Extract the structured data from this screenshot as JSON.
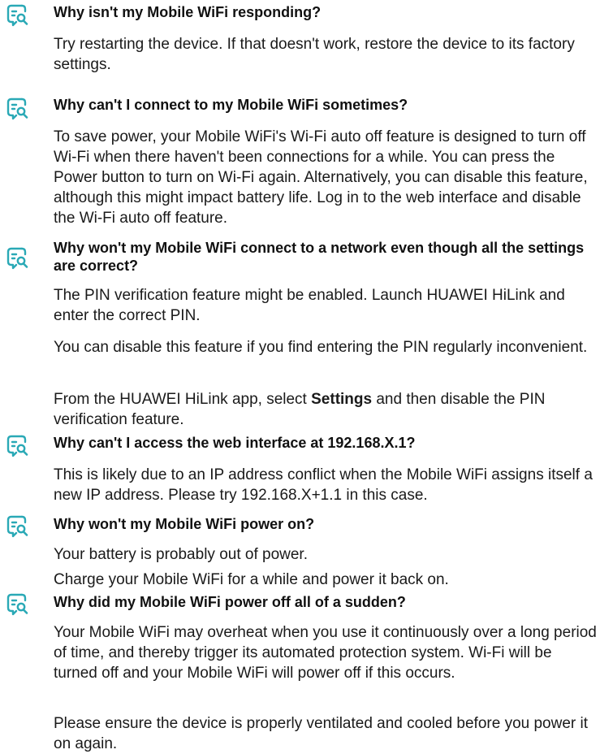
{
  "icon": {
    "name": "faq-search-icon",
    "color": "#2aa9b6"
  },
  "faqs": [
    {
      "question": "Why isn't my Mobile WiFi responding?",
      "answers": [
        "Try restarting the device. If that doesn't work, restore the device to its factory settings."
      ]
    },
    {
      "question": "Why can't I connect to my Mobile WiFi sometimes?",
      "answers": [
        "To save power, your Mobile WiFi's Wi-Fi auto off feature is designed to turn off Wi-Fi when there haven't been connections for a while. You can press the Power button to turn on Wi-Fi again. Alternatively, you can disable this feature, although this might impact battery life. Log in to the web interface and disable the Wi-Fi auto off feature."
      ]
    },
    {
      "question": "Why won't my Mobile WiFi connect to a network even though all the settings are correct?",
      "answers": [
        "The PIN verification feature might be enabled. Launch HUAWEI HiLink and enter the correct PIN.",
        "You can disable this feature if you find entering the PIN regularly inconvenient."
      ],
      "settings_paragraph": {
        "before": "From the HUAWEI HiLink app, select ",
        "bold": "Settings",
        "after": " and then disable the PIN verification feature."
      }
    },
    {
      "question": "Why can't I access the web interface at 192.168.X.1?",
      "answers": [
        "This is likely due to an IP address conflict when the Mobile WiFi assigns itself a new IP address. Please try 192.168.X+1.1 in this case."
      ]
    },
    {
      "question": "Why won't my Mobile WiFi power on?",
      "answers": [
        "Your battery is probably out of power.",
        "Charge your Mobile WiFi for a while and power it back on."
      ]
    },
    {
      "question": "Why did my Mobile WiFi power off all of a sudden?",
      "answers": [
        "Your Mobile WiFi may overheat when you use it continuously over a long period of time, and thereby trigger its automated protection system. Wi-Fi will be turned off and your Mobile WiFi will power off if this occurs.",
        "Please ensure the device is properly ventilated and cooled before you power it on again."
      ]
    }
  ]
}
